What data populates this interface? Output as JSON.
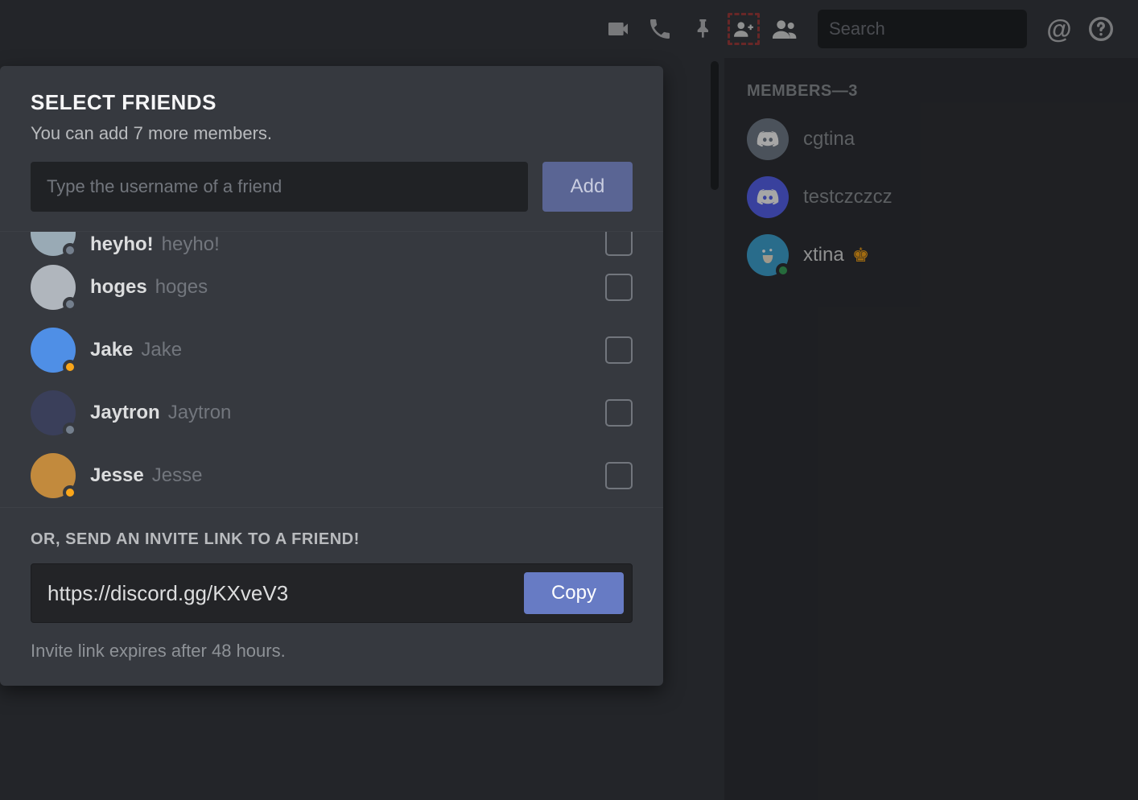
{
  "toolbar": {
    "search_placeholder": "Search"
  },
  "popover": {
    "title": "SELECT FRIENDS",
    "subtitle": "You can add 7 more members.",
    "search_placeholder": "Type the username of a friend",
    "add_label": "Add",
    "friends": [
      {
        "display": "heyho!",
        "handle": "heyho!",
        "avatar_bg": "#99aab5",
        "status": "offline"
      },
      {
        "display": "hoges",
        "handle": "hoges",
        "avatar_bg": "#b0b6bd",
        "status": "offline"
      },
      {
        "display": "Jake",
        "handle": "Jake",
        "avatar_bg": "#4f8fe6",
        "status": "idle"
      },
      {
        "display": "Jaytron",
        "handle": "Jaytron",
        "avatar_bg": "#3a3f5a",
        "status": "offline"
      },
      {
        "display": "Jesse",
        "handle": "Jesse",
        "avatar_bg": "#c28a3d",
        "status": "idle"
      }
    ],
    "invite_heading": "OR, SEND AN INVITE LINK TO A FRIEND!",
    "invite_link": "https://discord.gg/KXveV3",
    "copy_label": "Copy",
    "invite_expiry": "Invite link expires after 48 hours."
  },
  "members": {
    "heading": "MEMBERS—3",
    "list": [
      {
        "name": "cgtina",
        "avatar_bg": "#747f8d",
        "owner": false,
        "online": false
      },
      {
        "name": "testczczcz",
        "avatar_bg": "#5865f2",
        "owner": false,
        "online": false
      },
      {
        "name": "xtina",
        "avatar_bg": "#3fa7d6",
        "owner": true,
        "online": true
      }
    ]
  },
  "status_colors": {
    "offline": "#747f8d",
    "idle": "#faa61a",
    "online": "#3ba55d"
  }
}
